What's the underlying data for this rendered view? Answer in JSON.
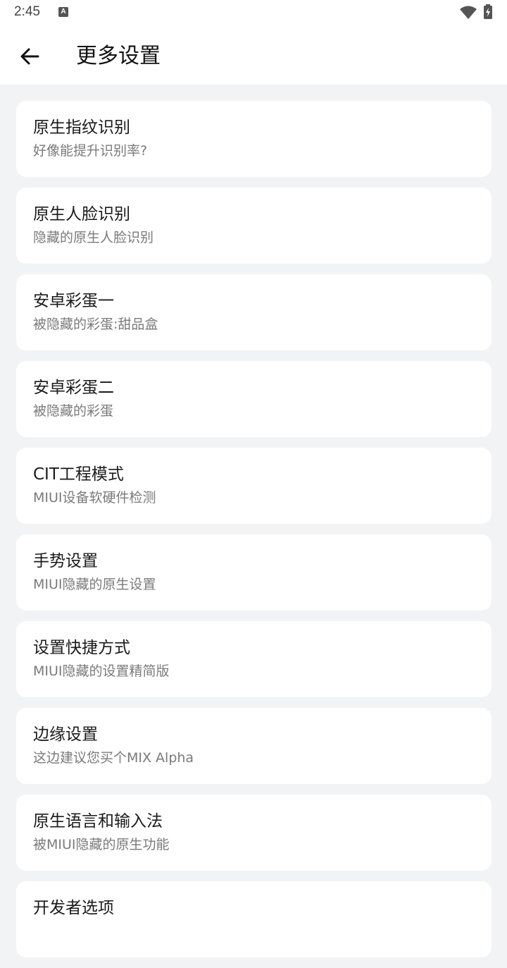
{
  "status_bar": {
    "time": "2:45",
    "notification_icon": "A",
    "icons": [
      "notification-icon",
      "wifi-icon",
      "battery-charging-icon"
    ]
  },
  "app_bar": {
    "back_icon": "arrow-back-icon",
    "title": "更多设置"
  },
  "items": [
    {
      "title": "原生指纹识别",
      "subtitle": "好像能提升识别率?"
    },
    {
      "title": "原生人脸识别",
      "subtitle": "隐藏的原生人脸识别"
    },
    {
      "title": "安卓彩蛋一",
      "subtitle": "被隐藏的彩蛋:甜品盒"
    },
    {
      "title": "安卓彩蛋二",
      "subtitle": "被隐藏的彩蛋"
    },
    {
      "title": "CIT工程模式",
      "subtitle": "MIUI设备软硬件检测"
    },
    {
      "title": "手势设置",
      "subtitle": "MIUI隐藏的原生设置"
    },
    {
      "title": "设置快捷方式",
      "subtitle": "MIUI隐藏的设置精简版"
    },
    {
      "title": "边缘设置",
      "subtitle": "这边建议您买个MIX Alpha"
    },
    {
      "title": "原生语言和输入法",
      "subtitle": "被MIUI隐藏的原生功能"
    },
    {
      "title": "开发者选项",
      "subtitle": ""
    }
  ],
  "colors": {
    "background": "#f2f3f5",
    "card": "#ffffff",
    "title_text": "#1a1a1a",
    "subtitle_text": "#7a7a7a"
  }
}
